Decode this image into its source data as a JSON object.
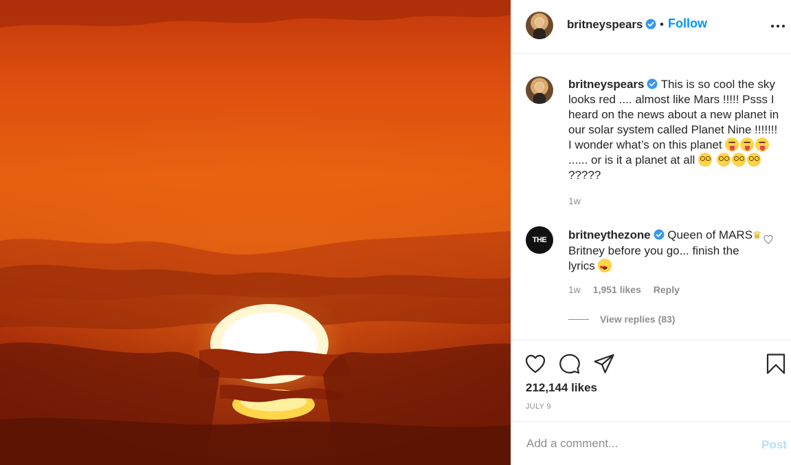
{
  "post": {
    "author": "britneyspears",
    "follow_label": "Follow",
    "dot": "•",
    "caption_text_1": "This is so cool the sky looks red .... almost like Mars !!!!! Psss I heard on the news about a new planet in our solar system called Planet Nine !!!!!!!  I wonder what’s on this planet ",
    "caption_text_2": " ...... or is it a planet at all ",
    "caption_text_3": " ?????",
    "caption_time": "1w",
    "likes": "212,144 likes",
    "date": "JULY 9"
  },
  "comment": {
    "author": "britneythezone",
    "avatar_text": "THE ZONE",
    "text_1": "Queen of MARS",
    "text_2": " Britney before you go... finish the lyrics ",
    "time": "1w",
    "likes": "1,951 likes",
    "reply_label": "Reply",
    "view_replies": "View replies (83)"
  },
  "composer": {
    "placeholder": "Add a comment...",
    "post_label": "Post"
  },
  "icons": {
    "verified": "verified-badge-icon",
    "more": "more-options-icon",
    "like": "heart-icon",
    "comment": "comment-bubble-icon",
    "share": "paper-plane-icon",
    "save": "bookmark-icon"
  },
  "colors": {
    "accent": "#0095f6",
    "post_disabled": "#b2dffc",
    "muted": "#8e8e8e",
    "verified": "#3897f0"
  }
}
